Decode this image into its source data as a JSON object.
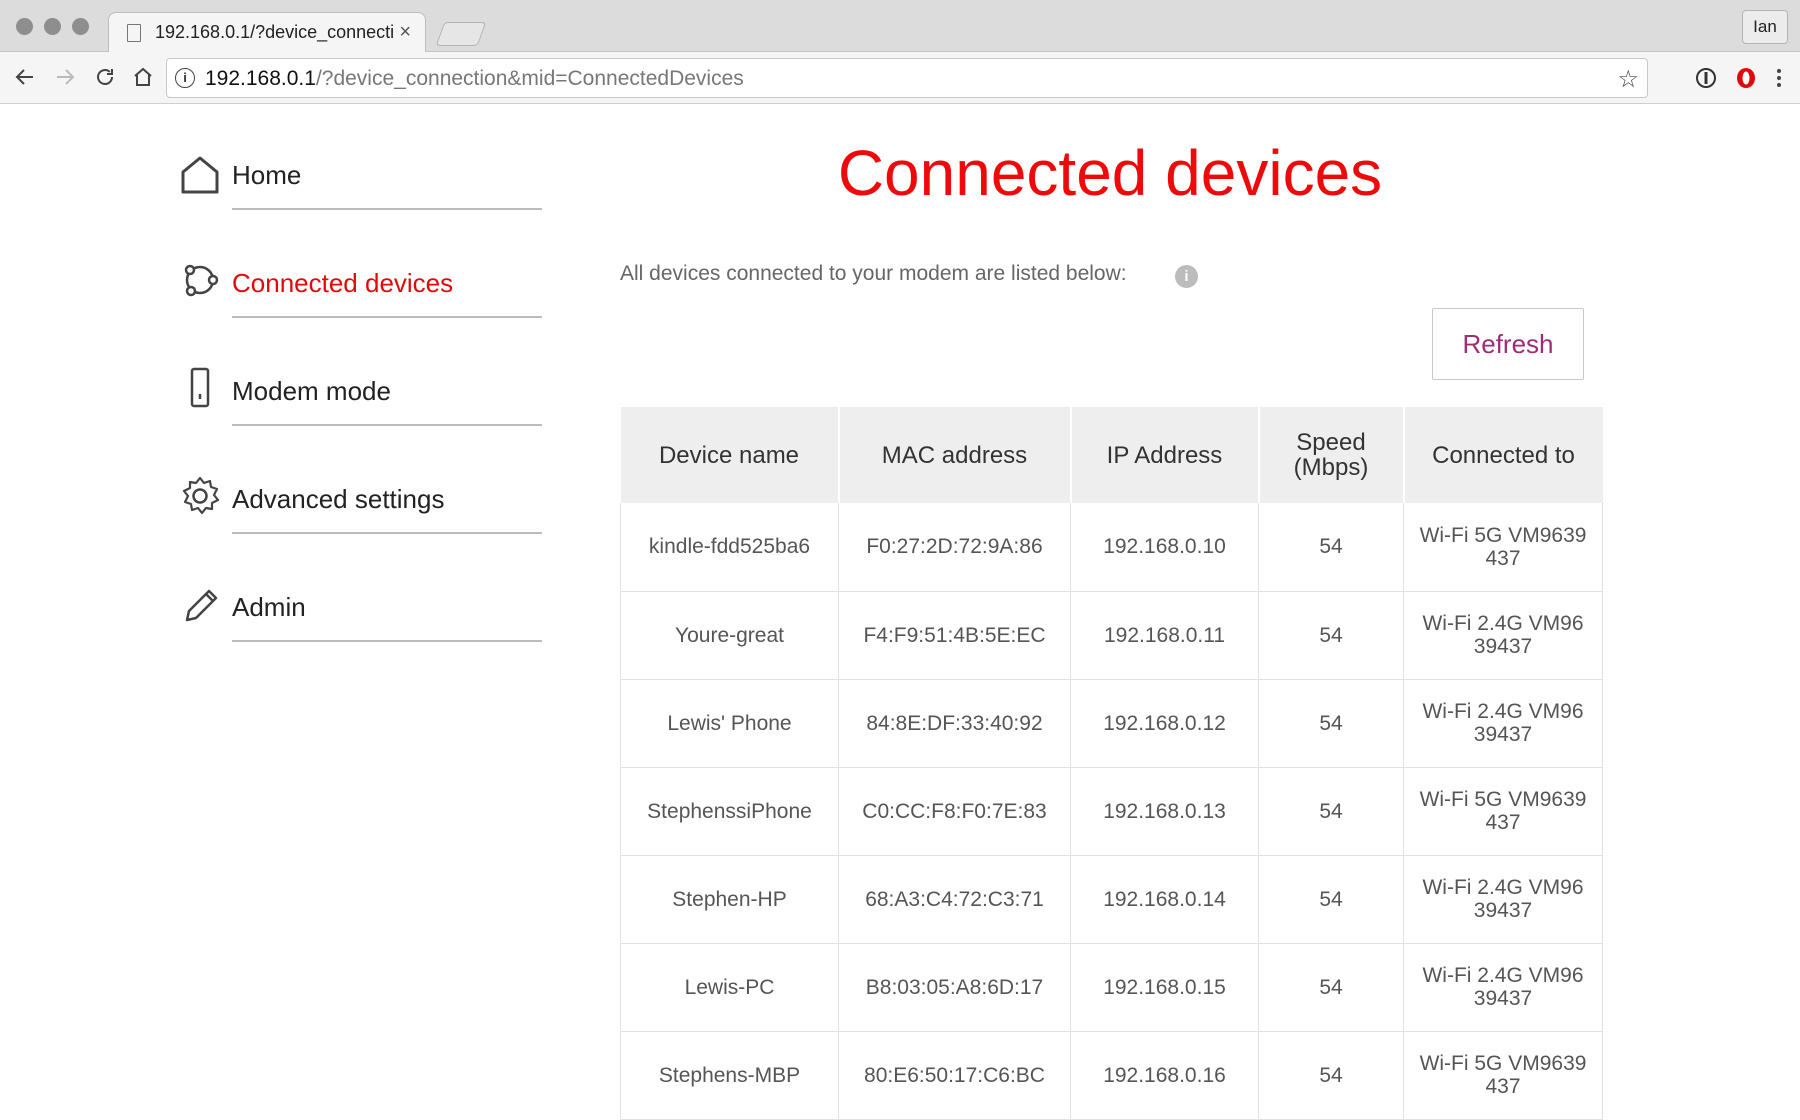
{
  "browser": {
    "tab_title": "192.168.0.1/?device_connecti",
    "tab_close": "×",
    "profile": "Ian",
    "url_host": "192.168.0.1",
    "url_path": "/?device_connection&mid=ConnectedDevices"
  },
  "sidebar": {
    "items": [
      {
        "label": "Home",
        "icon": "home-icon",
        "active": false
      },
      {
        "label": "Connected devices",
        "icon": "connected-devices-icon",
        "active": true
      },
      {
        "label": "Modem mode",
        "icon": "modem-icon",
        "active": false
      },
      {
        "label": "Advanced settings",
        "icon": "gear-icon",
        "active": false
      },
      {
        "label": "Admin",
        "icon": "pencil-icon",
        "active": false
      }
    ]
  },
  "main": {
    "title": "Connected devices",
    "subtitle": "All devices connected to your modem are listed below:",
    "info_icon": "i",
    "refresh_label": "Refresh"
  },
  "table": {
    "headers": [
      "Device name",
      "MAC address",
      "IP Address",
      "Speed (Mbps)",
      "Connected to"
    ],
    "rows": [
      [
        "kindle-fdd525ba6",
        "F0:27:2D:72:9A:86",
        "192.168.0.10",
        "54",
        "Wi-Fi 5G VM9639437"
      ],
      [
        "Youre-great",
        "F4:F9:51:4B:5E:EC",
        "192.168.0.11",
        "54",
        "Wi-Fi 2.4G VM9639437"
      ],
      [
        "Lewis' Phone",
        "84:8E:DF:33:40:92",
        "192.168.0.12",
        "54",
        "Wi-Fi 2.4G VM9639437"
      ],
      [
        "StephenssiPhone",
        "C0:CC:F8:F0:7E:83",
        "192.168.0.13",
        "54",
        "Wi-Fi 5G VM9639437"
      ],
      [
        "Stephen-HP",
        "68:A3:C4:72:C3:71",
        "192.168.0.14",
        "54",
        "Wi-Fi 2.4G VM9639437"
      ],
      [
        "Lewis-PC",
        "B8:03:05:A8:6D:17",
        "192.168.0.15",
        "54",
        "Wi-Fi 2.4G VM9639437"
      ],
      [
        "Stephens-MBP",
        "80:E6:50:17:C6:BC",
        "192.168.0.16",
        "54",
        "Wi-Fi 5G VM9639437"
      ]
    ]
  },
  "colors": {
    "brand_red": "#ee0a0a",
    "refresh_text": "#a02b76",
    "header_bg": "#eeeeee"
  }
}
